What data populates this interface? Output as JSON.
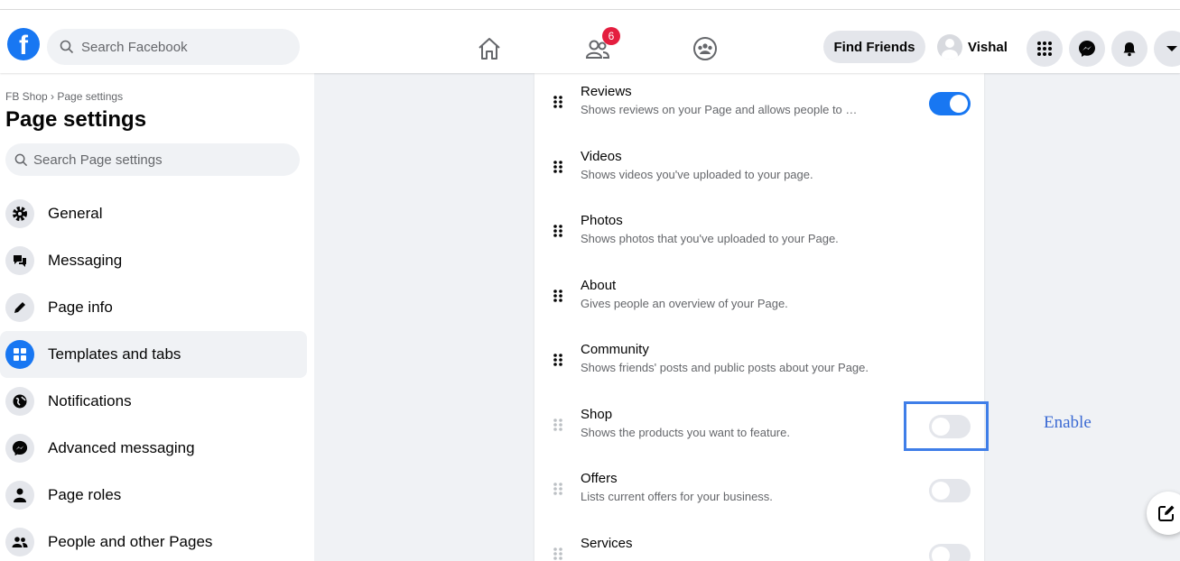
{
  "topbar": {
    "search_placeholder": "Search Facebook",
    "notification_count": "6",
    "find_friends_label": "Find Friends",
    "profile_name": "Vishal"
  },
  "sidebar": {
    "breadcrumb": "FB Shop › Page settings",
    "title": "Page settings",
    "search_placeholder": "Search Page settings",
    "items": [
      {
        "label": "General",
        "icon": "gear-icon"
      },
      {
        "label": "Messaging",
        "icon": "chat-bubbles-icon"
      },
      {
        "label": "Page info",
        "icon": "pencil-icon"
      },
      {
        "label": "Templates and tabs",
        "icon": "grid-icon",
        "active": true
      },
      {
        "label": "Notifications",
        "icon": "globe-icon"
      },
      {
        "label": "Advanced messaging",
        "icon": "messenger-icon"
      },
      {
        "label": "Page roles",
        "icon": "person-icon"
      },
      {
        "label": "People and other Pages",
        "icon": "people-icon"
      }
    ]
  },
  "tabs": [
    {
      "title": "Reviews",
      "desc": "Shows reviews on your Page and allows people to …",
      "toggle": "on"
    },
    {
      "title": "Videos",
      "desc": "Shows videos you've uploaded to your page."
    },
    {
      "title": "Photos",
      "desc": "Shows photos that you've uploaded to your Page."
    },
    {
      "title": "About",
      "desc": "Gives people an overview of your Page."
    },
    {
      "title": "Community",
      "desc": "Shows friends' posts and public posts about your Page."
    },
    {
      "title": "Shop",
      "desc": "Shows the products you want to feature.",
      "toggle": "off"
    },
    {
      "title": "Offers",
      "desc": "Lists current offers for your business.",
      "toggle": "off"
    },
    {
      "title": "Services",
      "desc": "",
      "toggle": "off"
    }
  ],
  "annotation": {
    "enable_label": "Enable"
  },
  "colors": {
    "accent": "#1877f2",
    "highlight_box": "#3f7ee8",
    "badge": "#e41e3f"
  }
}
